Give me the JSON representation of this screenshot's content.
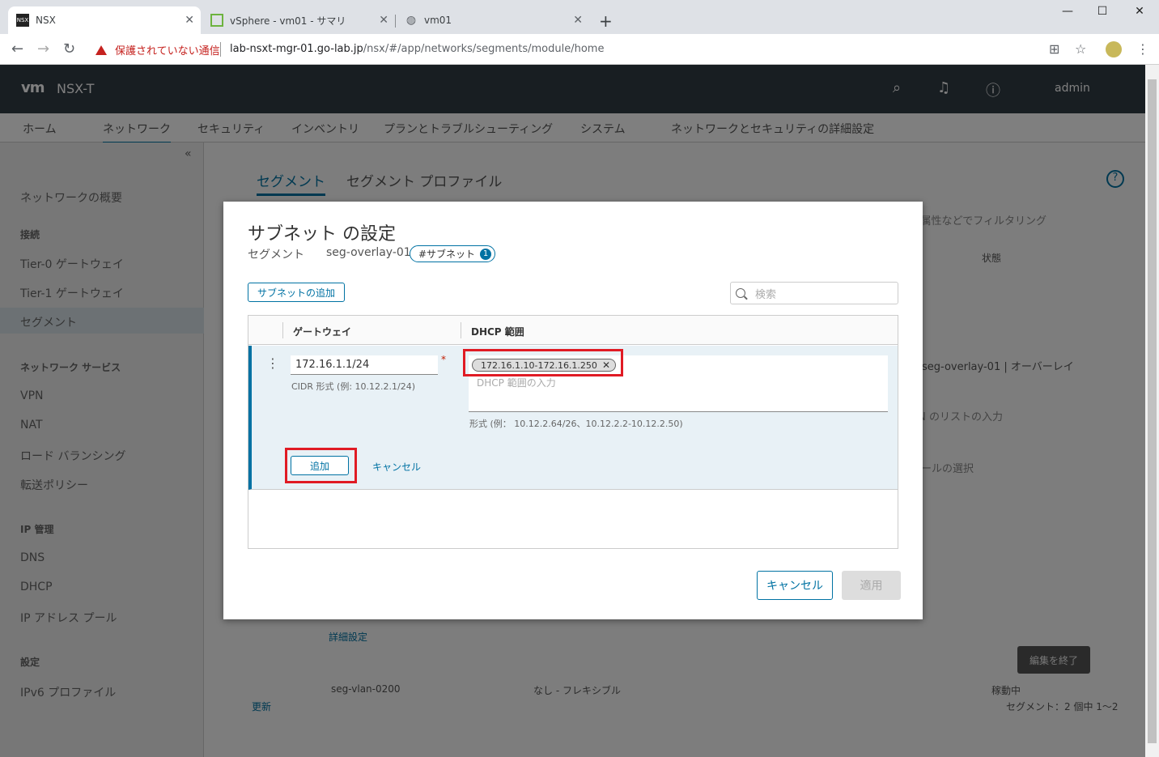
{
  "browser": {
    "tabs": [
      {
        "title": "NSX",
        "icon": "nsx-favicon"
      },
      {
        "title": "vSphere - vm01 - サマリ",
        "icon": "vsphere-favicon"
      },
      {
        "title": "vm01",
        "icon": "globe-icon"
      }
    ],
    "security_warning": "保護されていない通信",
    "url_host": "lab-nsxt-mgr-01.go-lab.jp",
    "url_path": "/nsx/#/app/networks/segments/module/home"
  },
  "app": {
    "logo": "vm",
    "title": "NSX-T",
    "user": "admin",
    "nav_tabs": [
      "ホーム",
      "ネットワーク",
      "セキュリティ",
      "インベントリ",
      "プランとトラブルシューティング",
      "システム",
      "ネットワークとセキュリティの詳細設定"
    ],
    "sidebar": {
      "overview": "ネットワークの概要",
      "section_connect": "接続",
      "tier0": "Tier-0 ゲートウェイ",
      "tier1": "Tier-1 ゲートウェイ",
      "segment": "セグメント",
      "section_services": "ネットワーク サービス",
      "vpn": "VPN",
      "nat": "NAT",
      "lb": "ロード バランシング",
      "forwarding": "転送ポリシー",
      "section_ip": "IP 管理",
      "dns": "DNS",
      "dhcp": "DHCP",
      "ip_pool": "IP アドレス プール",
      "section_settings": "設定",
      "ipv6": "IPv6 プロファイル"
    },
    "content_tabs": [
      "セグメント",
      "セグメント プロファイル"
    ],
    "bg": {
      "filter": "名前、パス、その他の属性などでフィルタリング",
      "col_state": "状態",
      "type_select": "seg-overlay-01 | オーバーレイ",
      "vlan_input": "VLAN のリストの入力",
      "pool_select": "プールの選択",
      "advanced": "詳細設定",
      "finish_edit": "編集を終了",
      "row2_name": "seg-vlan-0200",
      "row2_type": "なし - フレキシブル",
      "row2_status": "稼動中",
      "refresh": "更新",
      "footer_count": "セグメント：2 個中 1～2"
    }
  },
  "modal": {
    "title": "サブネット の設定",
    "segment_label": "セグメント",
    "segment_name": "seg-overlay-01",
    "subnet_pill": "#サブネット",
    "subnet_count": "1",
    "add_subnet_label": "サブネットの追加",
    "search_placeholder": "検索",
    "col_gateway": "ゲートウェイ",
    "col_dhcp": "DHCP 範囲",
    "gateway_value": "172.16.1.1/24",
    "gateway_help": "CIDR 形式 (例: 10.12.2.1/24)",
    "dhcp_chip": "172.16.1.10-172.16.1.250",
    "dhcp_placeholder": "DHCP 範囲の入力",
    "dhcp_help": "形式 (例： 10.12.2.64/26、10.12.2.2-10.12.2.50)",
    "add_label": "追加",
    "cancel_link": "キャンセル",
    "cancel_button": "キャンセル",
    "apply_button": "適用"
  },
  "colors": {
    "accent": "#0072a3",
    "highlight": "#e01b24",
    "header": "#313c45"
  }
}
